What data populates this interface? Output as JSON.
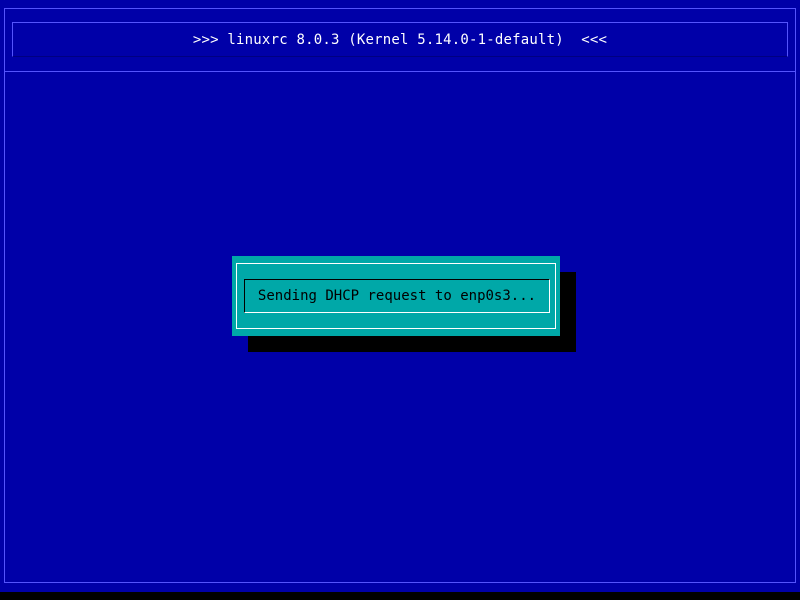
{
  "header": {
    "title": ">>> linuxrc 8.0.3 (Kernel 5.14.0-1-default)  <<<"
  },
  "dialog": {
    "message": "Sending DHCP request to enp0s3..."
  },
  "colors": {
    "background": "#0000a8",
    "frame": "#5454fc",
    "dialog": "#00a8a8",
    "shadow": "#000000",
    "title_text": "#ffffff",
    "message_text": "#000000"
  }
}
